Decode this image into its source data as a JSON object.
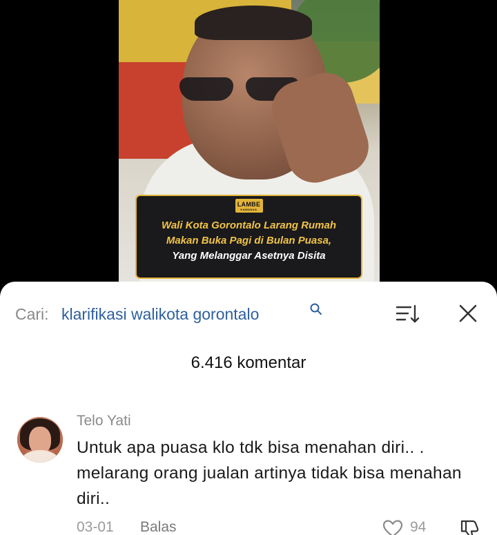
{
  "video": {
    "logo_top": "LAMBE",
    "logo_bottom": "KAWANUA",
    "caption": [
      "Wali Kota Gorontalo Larang Rumah",
      "Makan Buka Pagi di Bulan Puasa,",
      "Yang Melanggar Asetnya Disita"
    ]
  },
  "search": {
    "prefix": "Cari:",
    "query": "klarifikasi walikota gorontalo",
    "icon": "search-icon"
  },
  "toolbar": {
    "sort_icon": "sort-icon",
    "close_icon": "close-icon"
  },
  "comments_count": "6.416 komentar",
  "comment": {
    "author": "Telo Yati",
    "text": "Untuk apa puasa klo tdk bisa menahan diri.. . melarang orang jualan artinya tidak bisa menahan diri..",
    "date": "03-01",
    "reply_label": "Balas",
    "likes": "94"
  },
  "colors": {
    "caption_yellow": "#f1c447",
    "caption_border": "#e3b43a",
    "search_query": "#2d5f9e"
  }
}
